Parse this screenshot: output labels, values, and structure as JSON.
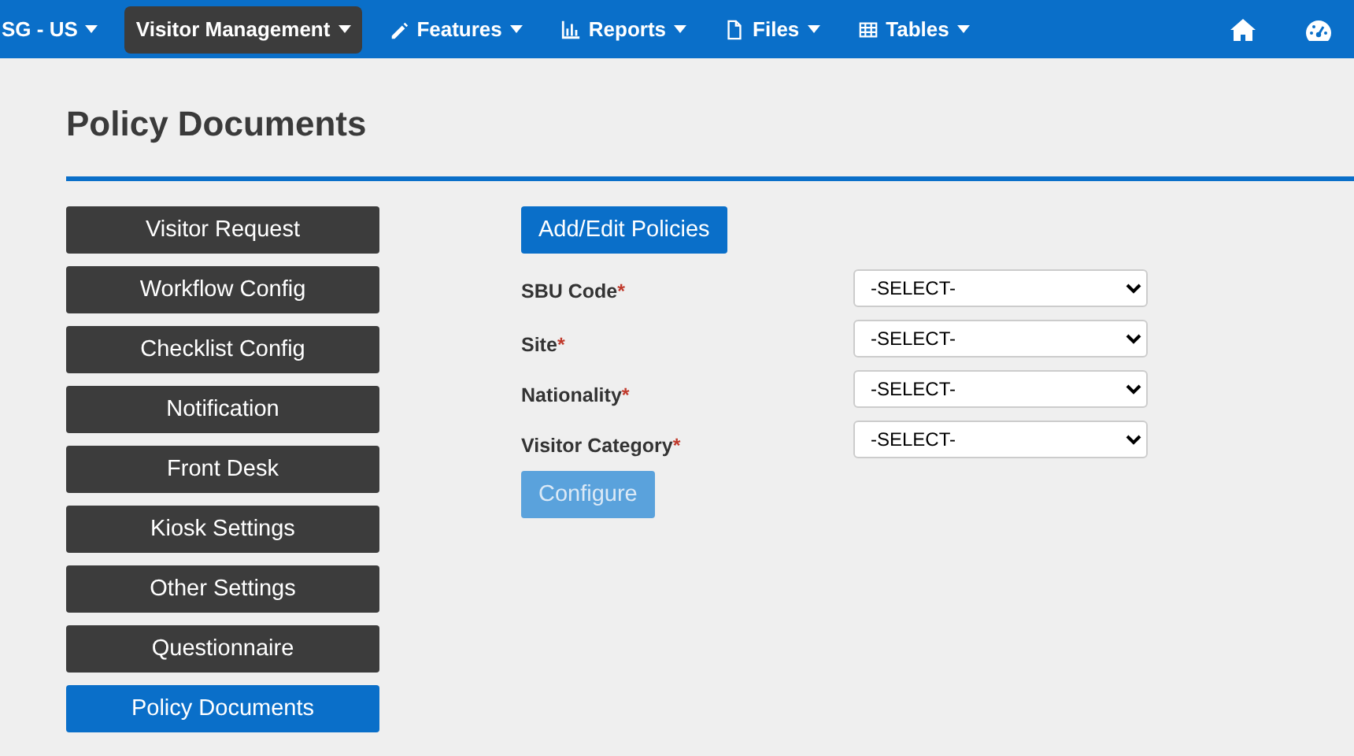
{
  "navbar": {
    "items": [
      {
        "label": "SG - US",
        "selected": false
      },
      {
        "label": "Visitor Management",
        "selected": true
      },
      {
        "label": "Features",
        "selected": false
      },
      {
        "label": "Reports",
        "selected": false
      },
      {
        "label": "Files",
        "selected": false
      },
      {
        "label": "Tables",
        "selected": false
      }
    ]
  },
  "page_title": "Policy Documents",
  "sidebar": {
    "items": [
      {
        "label": "Visitor Request",
        "selected": false
      },
      {
        "label": "Workflow Config",
        "selected": false
      },
      {
        "label": "Checklist Config",
        "selected": false
      },
      {
        "label": "Notification",
        "selected": false
      },
      {
        "label": "Front Desk",
        "selected": false
      },
      {
        "label": "Kiosk Settings",
        "selected": false
      },
      {
        "label": "Other Settings",
        "selected": false
      },
      {
        "label": "Questionnaire",
        "selected": false
      },
      {
        "label": "Policy Documents",
        "selected": true
      }
    ]
  },
  "form": {
    "top_button": {
      "label": "Add/Edit Policies",
      "disabled": false
    },
    "fields": [
      {
        "label": "SBU Code",
        "required_mark": "*",
        "value": "-SELECT-"
      },
      {
        "label": "Site",
        "required_mark": "*",
        "value": "-SELECT-"
      },
      {
        "label": "Nationality",
        "required_mark": "*",
        "value": "-SELECT-"
      },
      {
        "label": "Visitor Category",
        "required_mark": "*",
        "value": "-SELECT-"
      }
    ],
    "submit_button": {
      "label": "Configure",
      "disabled": true
    }
  }
}
